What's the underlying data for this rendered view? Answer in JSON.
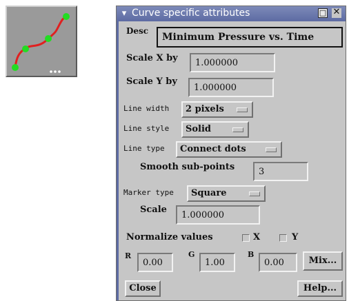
{
  "window": {
    "title": "Curve specific attributes",
    "menu_glyph": "▾",
    "minimize_glyph": "□",
    "close_glyph": "✕"
  },
  "desc": {
    "label": "Desc",
    "value": "Minimum Pressure vs. Time"
  },
  "scale_x": {
    "label": "Scale X by",
    "value": "1.000000"
  },
  "scale_y": {
    "label": "Scale Y by",
    "value": "1.000000"
  },
  "line_width": {
    "label": "Line width",
    "value": "2 pixels"
  },
  "line_style": {
    "label": "Line style",
    "value": "Solid"
  },
  "line_type": {
    "label": "Line type",
    "value": "Connect dots"
  },
  "smooth": {
    "label": "Smooth sub-points",
    "value": "3"
  },
  "marker_type": {
    "label": "Marker type",
    "value": "Square"
  },
  "scale": {
    "label": "Scale",
    "value": "1.000000"
  },
  "normalize": {
    "label": "Normalize values",
    "x_label": "X",
    "y_label": "Y"
  },
  "color": {
    "r_label": "R",
    "r_value": "0.00",
    "g_label": "G",
    "g_value": "1.00",
    "b_label": "B",
    "b_value": "0.00",
    "mix_label": "Mix..."
  },
  "buttons": {
    "close_label": "Close",
    "help_label": "Help..."
  },
  "icon": {
    "name": "curve-plot-icon",
    "curve_color": "#e02020",
    "point_color": "#22dd22",
    "background": "#9a9a9a"
  },
  "colors": {
    "titlebar": "#6a77ae",
    "panel": "#c6c6c6"
  }
}
